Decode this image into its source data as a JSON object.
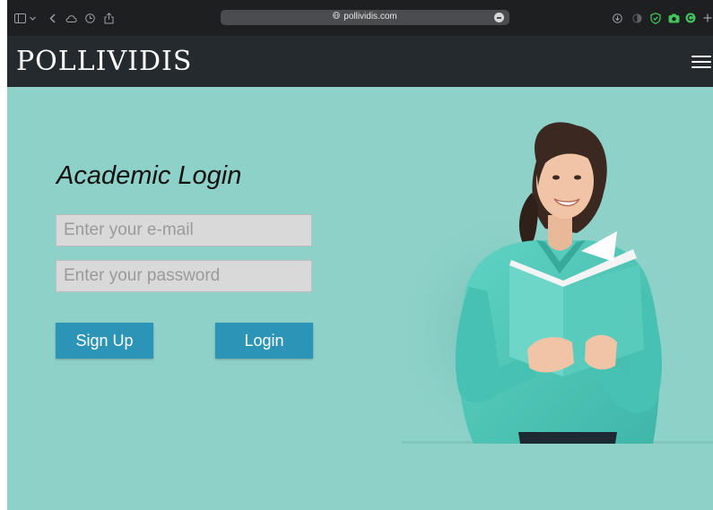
{
  "browser": {
    "url": "pollividis.com",
    "icons": [
      "sidebar-icon",
      "chevron-down-icon",
      "back-icon",
      "cloud-icon",
      "clock-icon",
      "share-icon",
      "download-icon",
      "contrast-icon",
      "shield-icon",
      "camera-icon",
      "extension-icon",
      "new-tab-icon"
    ]
  },
  "header": {
    "logo": "POLLIVIDIS",
    "menu_icon": "hamburger-menu-icon"
  },
  "login": {
    "title": "Academic Login",
    "email_placeholder": "Enter your e-mail",
    "email_value": "",
    "password_placeholder": "Enter your password",
    "password_value": "",
    "signup_label": "Sign Up",
    "login_label": "Login"
  },
  "hero": {
    "image": "woman-reading-book-photo"
  },
  "colors": {
    "background": "#8dd1c8",
    "header": "#242a2d",
    "button": "#2c94b6",
    "input": "#d9d9d9"
  }
}
